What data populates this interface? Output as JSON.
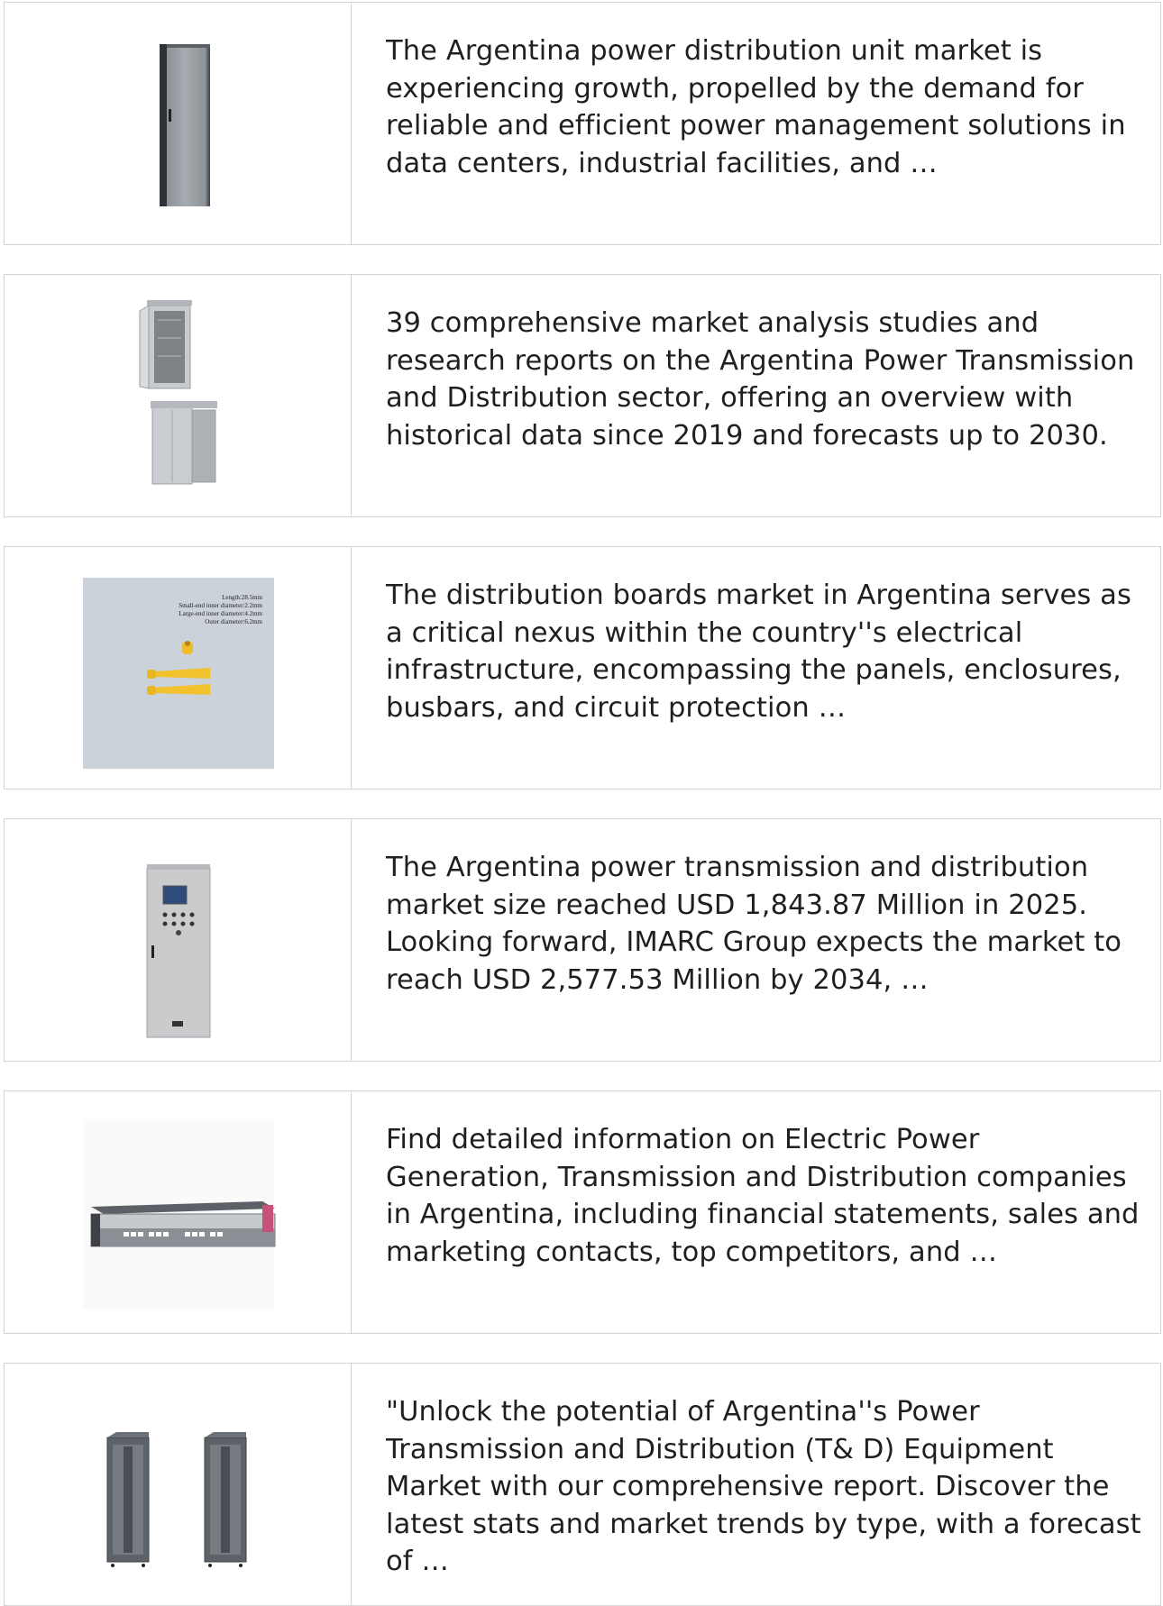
{
  "items": [
    {
      "text": "The Argentina power distribution unit market is experiencing growth, propelled by the demand for reliable and efficient power management solutions in data centers, industrial facilities, and …",
      "image": "tall-cabinet-icon"
    },
    {
      "text": "39 comprehensive market analysis studies and research reports on the Argentina Power Transmission and Distribution sector, offering an overview with historical data since 2019 and forecasts up to 2030.",
      "image": "outdoor-cabinets-icon"
    },
    {
      "text": "The distribution boards market in Argentina serves as a critical nexus within the country''s electrical infrastructure, encompassing the panels, enclosures, busbars, and circuit protection …",
      "image": "yellow-sleeves-photo",
      "image_labels": [
        "Length:28.5mm",
        "Small-end inner diameter:2.2mm",
        "Large-end inner diameter:4.2mm",
        "Outer diameter:6.2mm"
      ]
    },
    {
      "text": "The Argentina power transmission and distribution market size reached USD 1,843.87 Million in 2025. Looking forward, IMARC Group expects the market to reach USD 2,577.53 Million by 2034, …",
      "image": "control-panel-cabinet-icon"
    },
    {
      "text": "Find detailed information on Electric Power Generation, Transmission and Distribution companies in Argentina, including financial statements, sales and marketing contacts, top competitors, and …",
      "image": "rack-chassis-icon"
    },
    {
      "text": "\"Unlock the potential of Argentina''s Power Transmission and Distribution (T& D) Equipment Market with our comprehensive report. Discover the latest stats and market trends by type, with a forecast of …",
      "image": "server-racks-icon"
    }
  ],
  "colors": {
    "border": "#d3d3d3",
    "text": "#1f1f1f",
    "yellow": "#f2c12e"
  }
}
